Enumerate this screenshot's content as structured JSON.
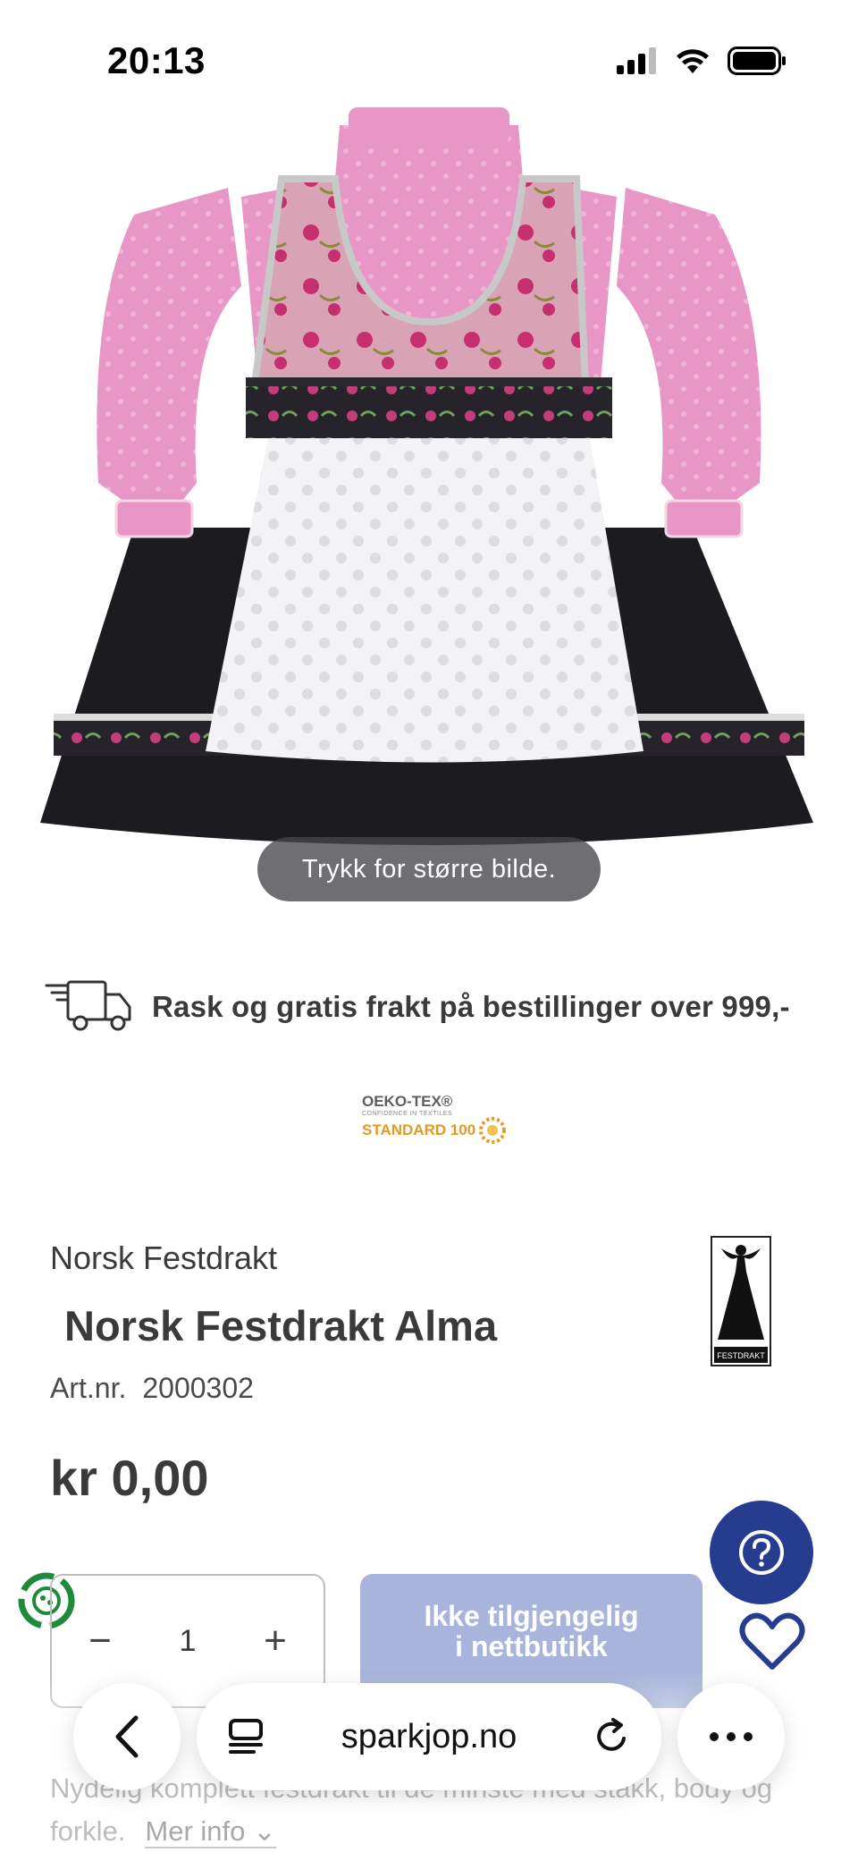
{
  "status_bar": {
    "time": "20:13",
    "icons": [
      "cellular-signal-icon",
      "wifi-icon",
      "battery-icon"
    ]
  },
  "product_image": {
    "hint": "Trykk for større bilde."
  },
  "shipping": {
    "icon": "delivery-truck-icon",
    "text": "Rask og gratis frakt på bestillinger over 999,-"
  },
  "certification": {
    "line1": "OEKO-TEX®",
    "line2": "CONFIDENCE IN TEXTILES",
    "line3": "STANDARD 100"
  },
  "product": {
    "brand": "Norsk Festdrakt",
    "title": "Norsk Festdrakt Alma",
    "art_label": "Art.nr.",
    "art_number": "2000302",
    "price": "kr 0,00",
    "brand_logo_text": "FESTDRAKT"
  },
  "purchase": {
    "quantity": "1",
    "minus_label": "−",
    "plus_label": "+",
    "unavailable_line1": "Ikke tilgjengelig",
    "unavailable_line2": "i nettbutikk"
  },
  "description": {
    "text": "Nydelig komplett festdrakt til de minste med stakk, body og forkle.",
    "more_label": "Mer info"
  },
  "browser": {
    "url": "sparkjop.no"
  },
  "colors": {
    "accent": "#263c8f",
    "unavailable_button": "#a8b4db",
    "certification_orange": "#e59a1d"
  }
}
